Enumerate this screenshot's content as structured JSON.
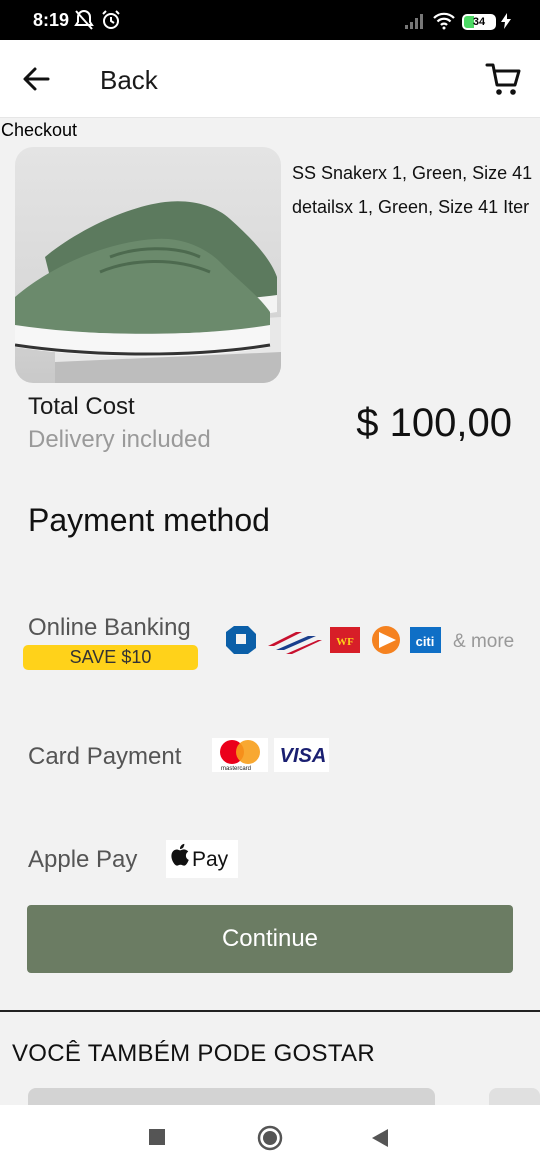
{
  "status_bar": {
    "time": "8:19",
    "battery": "34"
  },
  "header": {
    "back_label": "Back"
  },
  "page": {
    "title": "Checkout"
  },
  "product": {
    "description_line1": "SS Snakerx 1, Green, Size 41",
    "description_line2": "detailsx 1, Green, Size 41 Iter"
  },
  "total": {
    "label": "Total Cost",
    "sublabel": "Delivery included",
    "price": "$ 100,00"
  },
  "payment": {
    "heading": "Payment method",
    "online_banking": {
      "label": "Online Banking",
      "badge": "SAVE $10",
      "more": "& more",
      "logos": [
        "chase-icon",
        "bank-of-america-icon",
        "wells-fargo-icon",
        "td-bank-icon",
        "citi-icon"
      ],
      "wf_text": "WF",
      "citi_text": "citi"
    },
    "card": {
      "label": "Card Payment",
      "mastercard_text": "mastercard",
      "visa_text": "VISA"
    },
    "apple_pay": {
      "label": "Apple Pay",
      "logo_text": "Pay"
    }
  },
  "continue_label": "Continue",
  "recommendations": {
    "heading": "VOCÊ TAMBÉM PODE GOSTAR"
  },
  "colors": {
    "accent": "#6b7c63",
    "badge": "#ffd21a",
    "background": "#f2f2f2"
  }
}
